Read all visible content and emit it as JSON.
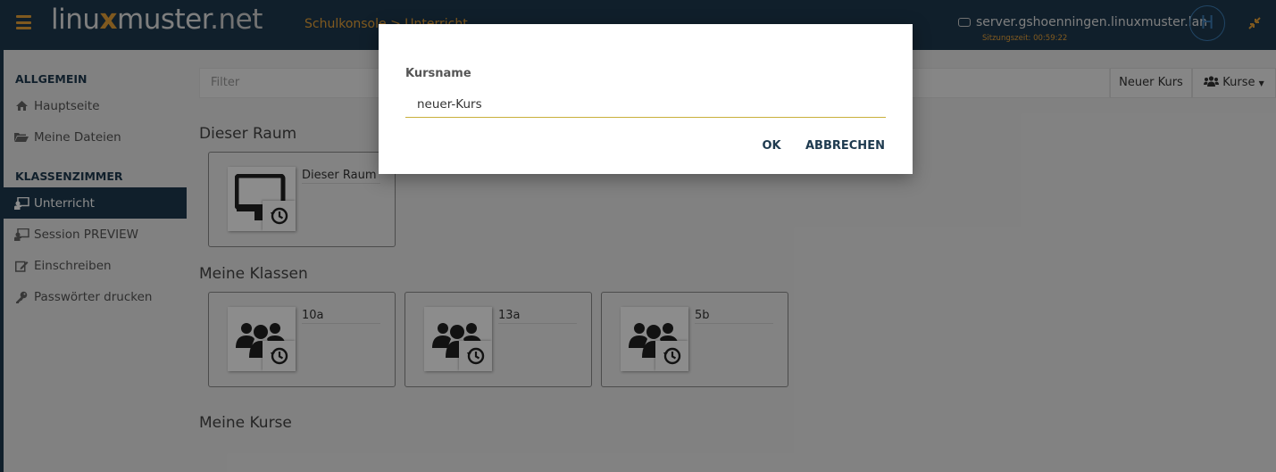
{
  "header": {
    "logo_left": "linu",
    "logo_x": "x",
    "logo_mid": "muster",
    "logo_right": ".net",
    "breadcrumb": "Schulkonsole > Unterricht",
    "server": "server.gshoenningen.linuxmuster.lan",
    "session": "Sitzungszeit: 00:59:22",
    "avatar_letter": "H"
  },
  "sidebar": {
    "sections": [
      {
        "title": "ALLGEMEIN"
      },
      {
        "title": "KLASSENZIMMER"
      }
    ],
    "items": [
      {
        "label": "Hauptseite",
        "icon": "home-icon"
      },
      {
        "label": "Meine Dateien",
        "icon": "folder-open-icon"
      },
      {
        "label": "Unterricht",
        "icon": "chalkboard-teacher-icon",
        "active": true
      },
      {
        "label": "Session PREVIEW",
        "icon": "chalkboard-teacher-icon"
      },
      {
        "label": "Einschreiben",
        "icon": "edit-icon"
      },
      {
        "label": "Passwörter drucken",
        "icon": "key-icon"
      }
    ]
  },
  "main": {
    "filter_placeholder": "Filter",
    "new_course": "Neuer Kurs",
    "courses_dropdown": "Kurse",
    "sections": {
      "room": "Dieser Raum",
      "classes": "Meine Klassen",
      "courses": "Meine Kurse"
    },
    "room_card": {
      "name": "Dieser Raum"
    },
    "class_cards": [
      {
        "name": "10a"
      },
      {
        "name": "13a"
      },
      {
        "name": "5b"
      }
    ]
  },
  "dialog": {
    "label": "Kursname",
    "value": "neuer-Kurs",
    "ok": "OK",
    "cancel": "ABBRECHEN"
  },
  "colors": {
    "header_bg": "#1e3a4f",
    "accent": "#e8a23a",
    "avatar": "#3d7fb8",
    "input_underline": "#c9b03c"
  }
}
